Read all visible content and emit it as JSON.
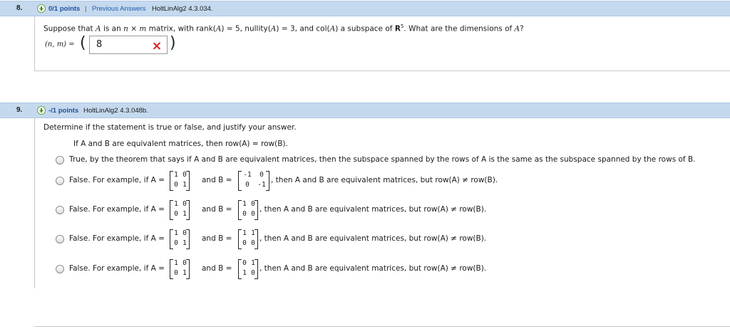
{
  "q8": {
    "number": "8.",
    "points": "0/1 points",
    "separator": "|",
    "previous_answers": "Previous Answers",
    "problem_id": "HoltLinAlg2 4.3.034.",
    "prompt_1": "Suppose that ",
    "prompt_A": "A",
    "prompt_2": " is an ",
    "prompt_n": "n",
    "prompt_times": " × ",
    "prompt_m": "m",
    "prompt_3": " matrix, with rank(",
    "prompt_A2": "A",
    "prompt_4": ") = 5,  nullity(",
    "prompt_A3": "A",
    "prompt_5": ") = 3,  and col(",
    "prompt_A4": "A",
    "prompt_6": ") a subspace of ",
    "prompt_R": "R",
    "prompt_exp": "5",
    "prompt_7": ". What are the dimensions of ",
    "prompt_A5": "A",
    "prompt_8": "?",
    "pair_label": "(n, m) =",
    "open_paren": "(",
    "close_paren": ")",
    "answer_value": "8",
    "status_icon": "incorrect-x-icon",
    "status_color": "#d9232a"
  },
  "q9": {
    "number": "9.",
    "points": "-/1 points",
    "problem_id": "HoltLinAlg2 4.3.048b.",
    "instruction": "Determine if the statement is true or false, and justify your answer.",
    "statement": "If A and B are equivalent matrices, then row(A) = row(B).",
    "options": [
      {
        "text": "True, by the theorem that says if A and B are equivalent matrices, then the subspace spanned by the rows of A is the same as the subspace spanned by the rows of B."
      },
      {
        "prefix": "False. For example, if A =",
        "A": [
          [
            "1",
            "0"
          ],
          [
            "0",
            "1"
          ]
        ],
        "mid": "and B =",
        "B": [
          [
            "-1",
            "0"
          ],
          [
            "0",
            "-1"
          ]
        ],
        "suffix": ", then A and B are equivalent matrices, but row(A) ≠ row(B)."
      },
      {
        "prefix": "False. For example, if A =",
        "A": [
          [
            "1",
            "0"
          ],
          [
            "0",
            "1"
          ]
        ],
        "mid": "and B =",
        "B": [
          [
            "1",
            "0"
          ],
          [
            "0",
            "0"
          ]
        ],
        "suffix": ", then A and B are equivalent matrices, but row(A) ≠ row(B)."
      },
      {
        "prefix": "False. For example, if A =",
        "A": [
          [
            "1",
            "0"
          ],
          [
            "0",
            "1"
          ]
        ],
        "mid": "and B =",
        "B": [
          [
            "1",
            "1"
          ],
          [
            "0",
            "0"
          ]
        ],
        "suffix": ", then A and B are equivalent matrices, but row(A) ≠ row(B)."
      },
      {
        "prefix": "False. For example, if A =",
        "A": [
          [
            "1",
            "0"
          ],
          [
            "0",
            "1"
          ]
        ],
        "mid": "and B =",
        "B": [
          [
            "0",
            "1"
          ],
          [
            "1",
            "0"
          ]
        ],
        "suffix": ", then A and B are equivalent matrices, but row(A) ≠ row(B)."
      }
    ]
  },
  "colors": {
    "header_bg": "#c5d9ee",
    "points_color": "#1f4f9a",
    "link_color": "#1f5fb0"
  }
}
